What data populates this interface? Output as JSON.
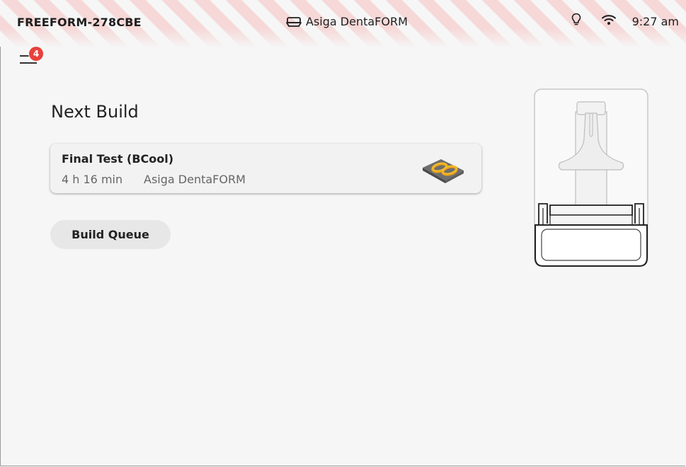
{
  "status_bar": {
    "device_name": "FREEFORM-278CBE",
    "printer_name": "Asiga DentaFORM",
    "printer_icon": "printer-icon",
    "bulb_icon": "lightbulb-icon",
    "wifi_icon": "wifi-icon",
    "time": "9:27 am",
    "stripe_color": "#f6d8d8"
  },
  "menu": {
    "icon": "hamburger-menu-icon",
    "badge_count": "4",
    "badge_color": "#e8413d"
  },
  "main": {
    "title": "Next Build",
    "build_card": {
      "name": "Final Test (BCool)",
      "duration": "4 h 16 min",
      "printer": "Asiga DentaFORM",
      "thumbnail_icon": "build-model-thumbnail"
    },
    "queue_button_label": "Build Queue"
  },
  "illustration": {
    "icon": "printer-illustration"
  }
}
